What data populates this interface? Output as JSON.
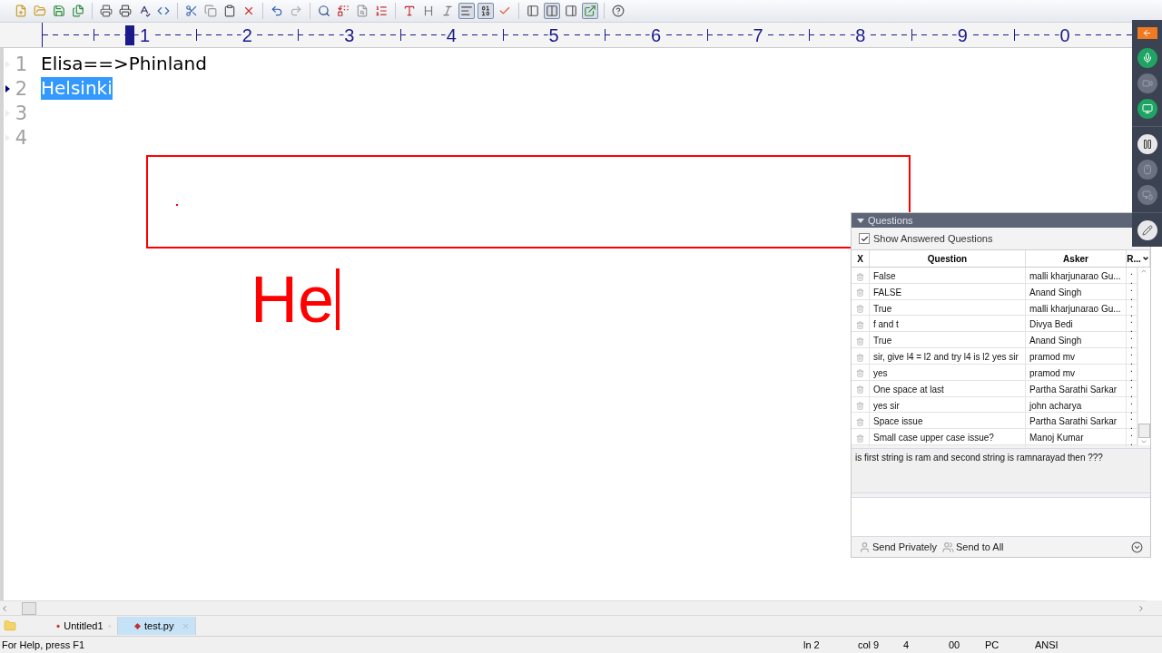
{
  "ruler": {
    "numbers": [
      "1",
      "2",
      "3",
      "4",
      "5",
      "6",
      "7",
      "8",
      "9",
      "0"
    ],
    "cursor": {
      "level": 0.076
    }
  },
  "editor": {
    "lines": [
      {
        "number": "1",
        "text": "Elisa==>Phinland",
        "selected": false,
        "current": false
      },
      {
        "number": "2",
        "text": "Helsinki",
        "selected": true,
        "current": true
      },
      {
        "number": "3",
        "current": false
      },
      {
        "number": "4",
        "current": false
      }
    ]
  },
  "annotation": {
    "typed_text": "He"
  },
  "session_controls": [
    {
      "kind": "back"
    },
    {
      "kind": "microphone",
      "on": true
    },
    {
      "kind": "camera",
      "on": false
    },
    {
      "kind": "screen",
      "on": true
    },
    {
      "kind": "pause",
      "on": true
    },
    {
      "kind": "mouse",
      "on": false
    },
    {
      "kind": "screens",
      "on": false
    },
    {
      "kind": "pen",
      "on": true
    }
  ],
  "questions_panel": {
    "title": "Questions",
    "expanded": true,
    "show_answered": {
      "label": "Show Answered Questions",
      "checked": true
    },
    "columns": [
      "X",
      "Question",
      "Asker",
      "R..."
    ],
    "rows": [
      {
        "question": "False",
        "asker": "malli kharjunarao Gu...",
        "column_3": ".."
      },
      {
        "question": "FALSE",
        "asker": "Anand Singh",
        "column_3": ".."
      },
      {
        "question": "True",
        "asker": "malli kharjunarao Gu...",
        "column_3": ".."
      },
      {
        "question": "f and t",
        "asker": "Divya Bedi",
        "column_3": ".."
      },
      {
        "question": "True",
        "asker": "Anand Singh",
        "column_3": ".."
      },
      {
        "question": "sir, give l4 = l2 and try l4 is l2   yes sir",
        "asker": "pramod mv",
        "column_3": ".."
      },
      {
        "question": "yes",
        "asker": "pramod mv",
        "column_3": ".."
      },
      {
        "question": "One space at last",
        "asker": "Partha Sarathi Sarkar",
        "column_3": ".."
      },
      {
        "question": "yes sir",
        "asker": "john acharya",
        "column_3": ".."
      },
      {
        "question": "Space issue",
        "asker": "Partha Sarathi Sarkar",
        "column_3": ".."
      },
      {
        "question": "Small case upper case issue?",
        "asker": "Manoj Kumar",
        "column_3": ".."
      }
    ],
    "selected_question": "is first string is ram and second string is ramnarayad then ???",
    "buttons": [
      "Send Privately",
      "Send to All"
    ]
  },
  "tabs": [
    {
      "label": "Untitled1",
      "selected": false
    },
    {
      "label": "test.py",
      "selected": true
    }
  ],
  "status_bar": {
    "help": "For Help, press F1",
    "fields": [
      "ln 2",
      "col 9",
      "4",
      "00",
      "PC",
      "ANSI"
    ]
  }
}
